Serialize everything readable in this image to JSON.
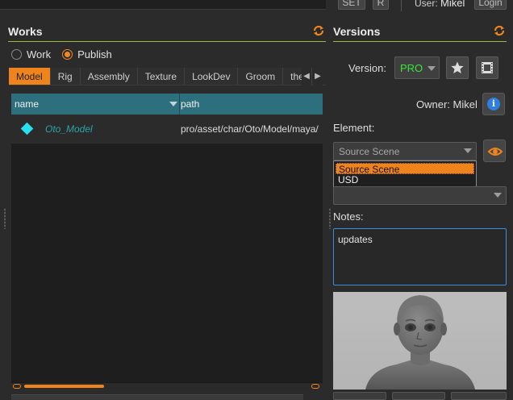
{
  "topbar": {
    "set_label": "SET",
    "r_label": "R",
    "user_prefix": "User:",
    "user_name": "Mikel",
    "login_label": "Login"
  },
  "works": {
    "title": "Works",
    "radios": [
      {
        "label": "Work",
        "checked": false
      },
      {
        "label": "Publish",
        "checked": true
      }
    ],
    "tabs": [
      {
        "label": "Model",
        "active": true
      },
      {
        "label": "Rig"
      },
      {
        "label": "Assembly"
      },
      {
        "label": "Texture"
      },
      {
        "label": "LookDev"
      },
      {
        "label": "Groom"
      },
      {
        "label": "the"
      }
    ],
    "table": {
      "columns": [
        "name",
        "path"
      ],
      "rows": [
        {
          "name": "Oto_Model",
          "path": "pro/asset/char/Oto/Model/maya/"
        }
      ]
    },
    "scroll_position": 0.28
  },
  "versions": {
    "title": "Versions",
    "version_label": "Version:",
    "version_value": "PRO",
    "owner_label": "Owner:",
    "owner_value": "Mikel",
    "element_label": "Element:",
    "element_value": "Source Scene",
    "element_options": [
      "Source Scene",
      "USD"
    ],
    "second_combo_value": "",
    "notes_label": "Notes:",
    "notes_text": "updates"
  },
  "colors": {
    "accent": "#f0841c",
    "title_underline": "#8fbf3c",
    "table_header": "#2e6f7d",
    "item_name": "#2ea3a8",
    "version_text": "#39e639",
    "info_blue": "#2f7fe0",
    "focus_border": "#3b8de0"
  }
}
